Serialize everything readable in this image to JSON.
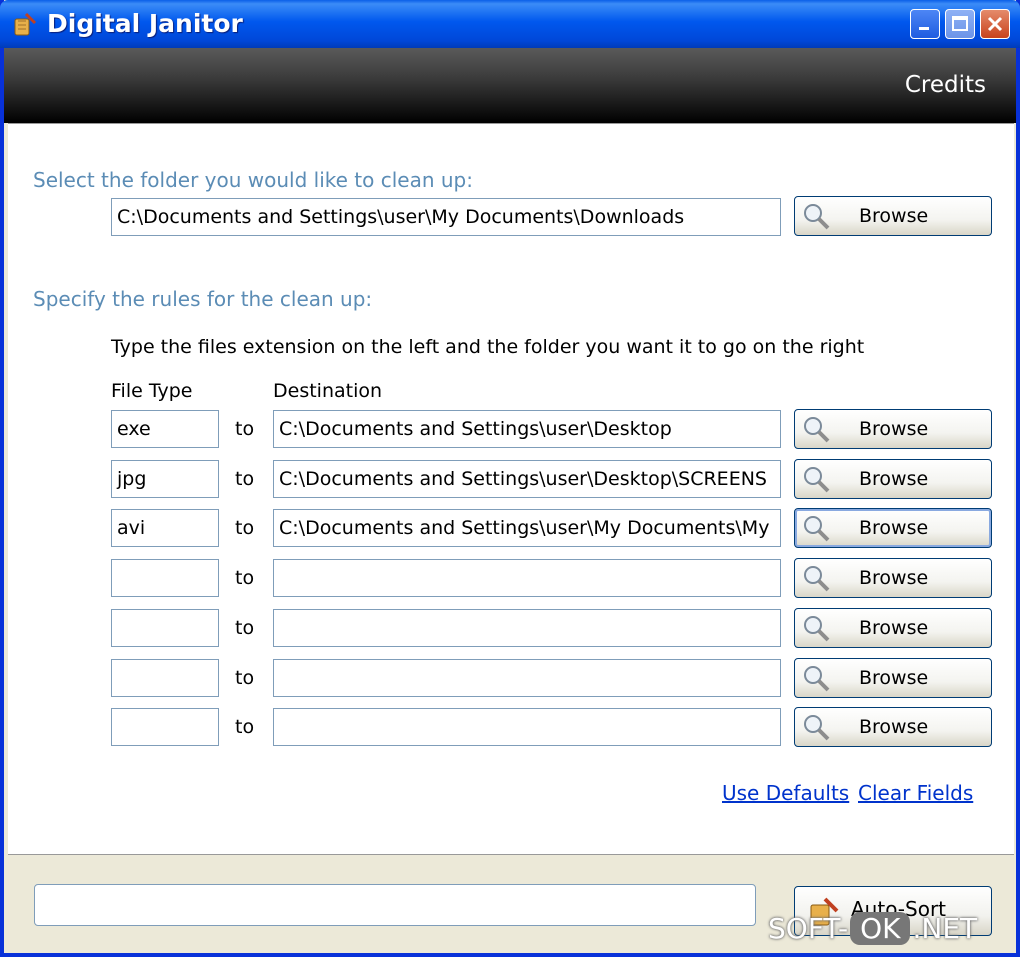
{
  "window": {
    "title": "Digital Janitor"
  },
  "header": {
    "credits_label": "Credits"
  },
  "folder_section": {
    "label": "Select the folder you would like to clean up:",
    "path_value": "C:\\Documents and Settings\\user\\My Documents\\Downloads",
    "browse_label": "Browse"
  },
  "rules_section": {
    "label": "Specify the rules for the clean up:",
    "hint": "Type the files extension on the left and the folder you want it to go on the right",
    "col_file_type": "File Type",
    "col_destination": "Destination",
    "to_label": "to",
    "browse_label": "Browse",
    "rows": [
      {
        "ext": "exe",
        "dest": "C:\\Documents and Settings\\user\\Desktop"
      },
      {
        "ext": "jpg",
        "dest": "C:\\Documents and Settings\\user\\Desktop\\SCREENS"
      },
      {
        "ext": "avi",
        "dest": "C:\\Documents and Settings\\user\\My Documents\\My"
      },
      {
        "ext": "",
        "dest": ""
      },
      {
        "ext": "",
        "dest": ""
      },
      {
        "ext": "",
        "dest": ""
      },
      {
        "ext": "",
        "dest": ""
      }
    ]
  },
  "links": {
    "use_defaults": "Use Defaults",
    "clear_fields": "Clear Fields"
  },
  "footer": {
    "status_value": "",
    "autosort_label": "Auto-Sort"
  },
  "watermark": {
    "left": "SOFT-",
    "ok": "OK",
    "right": ".NET"
  },
  "colors": {
    "section_label": "#5b8cb5",
    "link": "#0033cc",
    "title_bar": "#0058ee"
  },
  "icons": [
    "app-broom-icon",
    "minimize-icon",
    "maximize-icon",
    "close-icon",
    "magnifier-icon",
    "broom-icon"
  ]
}
